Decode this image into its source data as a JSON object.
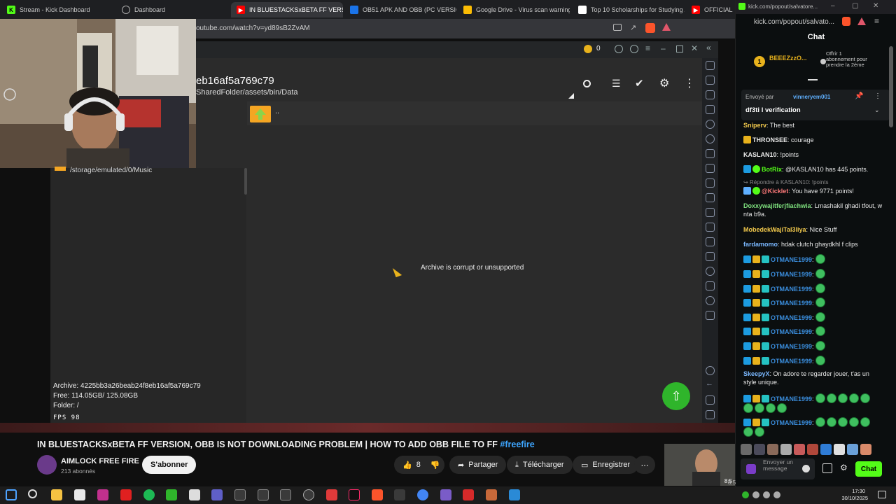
{
  "browser": {
    "tabs": [
      {
        "title": "Stream - Kick Dashboard",
        "icon": "kick-icon"
      },
      {
        "title": "Dashboard",
        "icon": "globe-icon"
      },
      {
        "title": "IN BLUESTACKSxBETA FF VERSIO",
        "icon": "youtube-icon"
      },
      {
        "title": "OB51 APK AND OBB (PC VERSION) i",
        "icon": "drive-icon"
      },
      {
        "title": "Google Drive - Virus scan warning",
        "icon": "drive-icon"
      },
      {
        "title": "Top 10 Scholarships for Studying Ab",
        "icon": "page-icon"
      },
      {
        "title": "OFFICIAL",
        "icon": "youtube-icon"
      }
    ],
    "url": "outube.com/watch?v=yd89sB2ZvAM"
  },
  "emulator": {
    "coins": "0",
    "title": "eb16af5a769c79",
    "path": "SharedFolder/assets/bin/Data",
    "parent_dir": "..",
    "left_path": "/storage/emulated/0/Music",
    "message": "Archive is corrupt or unsupported",
    "info": {
      "archive": "Archive: 4225bb3a26beab24f8eb16af5a769c79",
      "free": "Free: 114.05GB/ 125.08GB",
      "folder": "Folder: /",
      "fps": "FPS   98"
    }
  },
  "youtube": {
    "title": "IN BLUESTACKSxBETA FF VERSION, OBB IS NOT DOWNLOADING PROBLEM | HOW TO ADD OBB FILE TO FF",
    "hashtag": "#freefire",
    "channel": "AIMLOCK FREE FIRE",
    "subscribers": "213 abonnés",
    "subscribe": "S'abonner",
    "likes": "8",
    "share": "Partager",
    "download": "Télécharger",
    "save": "Enregistrer",
    "timestamp": "8:5"
  },
  "chat": {
    "url": "kick.com/popout/salvato...",
    "url_tab": "kick.com/popout/salvatore...",
    "header": "Chat",
    "top_gifter": {
      "rank": "1",
      "name": "BEEEZzzO...",
      "offer": "Offrir 1 abonnement pour prendre la 2ème"
    },
    "pinned": {
      "label": "Envoyé par",
      "user": "vinneryem001",
      "text": "df3ti l verification"
    },
    "messages": [
      {
        "user": "Sniperv",
        "text": "The best",
        "color": "#f2c94c"
      },
      {
        "user": "THRONSEE",
        "text": "courage",
        "color": "#ffffff"
      },
      {
        "user": "KASLAN10",
        "text": "!points",
        "color": "#ffffff"
      },
      {
        "user": "BotRix",
        "text": "@KASLAN10 has 445 points.",
        "color": "#53fc18"
      },
      {
        "reply": "Répondre à KASLAN10: !points"
      },
      {
        "user": "@Kicklet",
        "text": "You have 9771 points!",
        "color": "#ff7a7a"
      },
      {
        "user": "Doxxywajitferjfiachwia",
        "text": "Lmashakil ghadi tfout, w nta b9a.",
        "color": "#7ee07e"
      },
      {
        "user": "MobedekWajiTal3liya",
        "text": "Nice Stuff",
        "color": "#f2c94c"
      },
      {
        "user": "fardamomo",
        "text": "hdak clutch ghaydkhl f clips",
        "color": "#7ab8ff"
      },
      {
        "user": "OTMANE1999",
        "text": ""
      },
      {
        "user": "OTMANE1999",
        "text": ""
      },
      {
        "user": "OTMANE1999",
        "text": ""
      },
      {
        "user": "OTMANE1999",
        "text": ""
      },
      {
        "user": "OTMANE1999",
        "text": ""
      },
      {
        "user": "OTMANE1999",
        "text": ""
      },
      {
        "user": "OTMANE1999",
        "text": ""
      },
      {
        "user": "OTMANE1999",
        "text": ""
      },
      {
        "user": "SkeepyX",
        "text": "On adore te regarder jouer, t'as un style unique.",
        "color": "#7ab8ff"
      },
      {
        "user": "OTMANE1999",
        "text": ""
      },
      {
        "user": "OTMANE1999",
        "text": ""
      }
    ],
    "input_placeholder": "Envoyer un message",
    "send": "Chat"
  },
  "taskbar": {
    "time": "17:30",
    "date": "30/10/2025"
  },
  "colors": {
    "kick_green": "#53fc18",
    "youtube_red": "#ff0000",
    "fab_green": "#2fb52b",
    "folder_orange": "#f5a623"
  }
}
